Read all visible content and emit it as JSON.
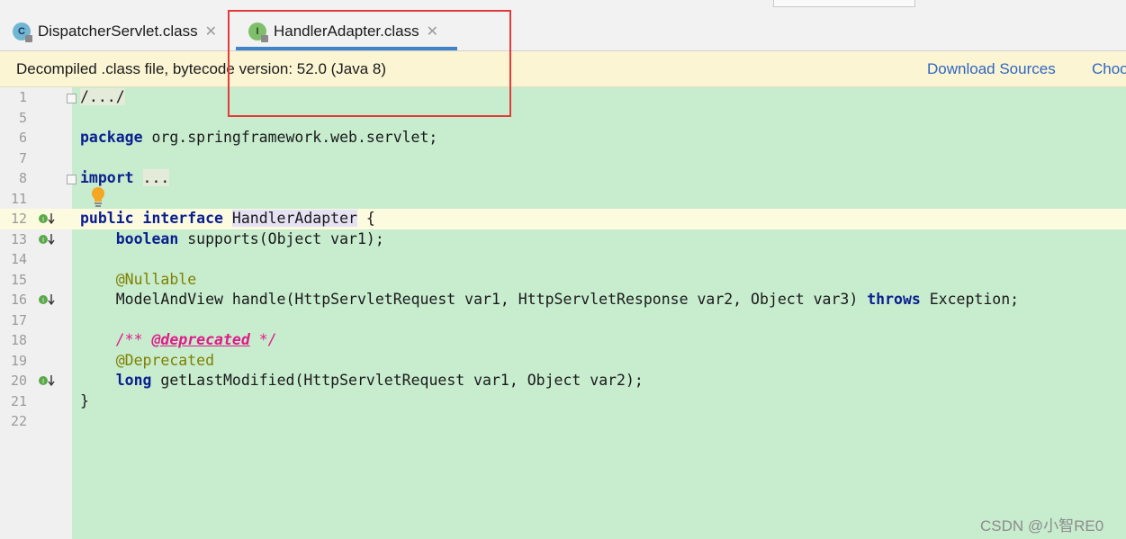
{
  "tabs": [
    {
      "label": "DispatcherServlet.class",
      "icon": "C",
      "active": false
    },
    {
      "label": "HandlerAdapter.class",
      "icon": "I",
      "active": true
    }
  ],
  "banner": {
    "message": "Decompiled .class file, bytecode version: 52.0 (Java 8)",
    "download_sources": "Download Sources",
    "choose_sources": "Choo"
  },
  "lines": {
    "l1": "1",
    "l5": "5",
    "l6": "6",
    "l7": "7",
    "l8": "8",
    "l11": "11",
    "l12": "12",
    "l13": "13",
    "l14": "14",
    "l15": "15",
    "l16": "16",
    "l17": "17",
    "l18": "18",
    "l19": "19",
    "l20": "20",
    "l21": "21",
    "l22": "22"
  },
  "code": {
    "fold_header": "/.../",
    "package_kw": "package",
    "package_name": " org.springframework.web.servlet;",
    "import_kw": "import",
    "import_fold": "...",
    "public_kw": "public",
    "interface_kw": "interface",
    "class_name": "HandlerAdapter",
    "open_brace": " {",
    "boolean_kw": "boolean",
    "supports_sig": " supports(Object var1);",
    "nullable_ann": "@Nullable",
    "handle_sig": "ModelAndView handle(HttpServletRequest var1, HttpServletResponse var2, Object var3) ",
    "throws_kw": "throws",
    "exception": " Exception;",
    "doc_open": "/** ",
    "doc_tag": "@deprecated",
    "doc_close": " */",
    "deprecated_ann": "@Deprecated",
    "long_kw": "long",
    "last_modified_sig": " getLastModified(HttpServletRequest var1, Object var2);",
    "close_brace": "}"
  },
  "watermark": "CSDN @小智RE0",
  "colors": {
    "editor_bg": "#c7ecce",
    "keyword": "#0a1f8f",
    "annotation": "#808000",
    "doc_comment": "#df1c88",
    "link": "#2f66c2",
    "highlight_box": "#e33b3b"
  }
}
